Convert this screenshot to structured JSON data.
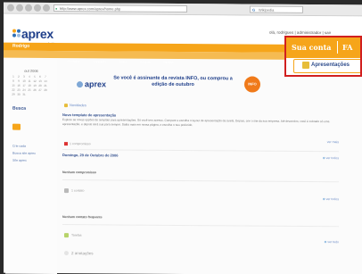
{
  "browser": {
    "url": "http://www.aprex.com/aprex/home.php",
    "search_placeholder": "Wikipedia",
    "right_text": "olá, rodrigues | administrador | sair"
  },
  "site": {
    "logo_text": "aprex",
    "logo_sub": "beta",
    "menu_label": "Rodrigo",
    "user_info": "olá, rodrigues | administrador | sair",
    "subnav_tabs": [
      "Home",
      "Compromissos",
      "Contatos",
      "Conteúdo",
      "Fotos",
      "Grupos",
      "Tarefas"
    ]
  },
  "sidebar": {
    "calendar_title": "out 2006",
    "calendar_days": [
      "1",
      "2",
      "3",
      "4",
      "5",
      "6",
      "7",
      "8",
      "9",
      "10",
      "11",
      "12",
      "13",
      "14",
      "15",
      "16",
      "17",
      "18",
      "19",
      "20",
      "21",
      "22",
      "23",
      "24",
      "25",
      "26",
      "27",
      "28",
      "29",
      "30",
      "31"
    ],
    "section_heading": "Busca",
    "links": [
      "Crie cada",
      "Busca site aprex",
      "Site aprex"
    ]
  },
  "banner": {
    "logo": "aprex",
    "text": "Se você é assinante da revista INFO, ou comprou a edição de outubro",
    "badge": "INFO"
  },
  "content": {
    "bullet_head": "Novidades",
    "title": "Novo template de apresentação",
    "paragraph": "Explore as novas opções de template para apresentações. Só você tem acesso. Compare e escolha o layout de apresentação da tarefa. Depois, crie o site da sua empresa. Até dezembro, você é cobrado só uma apresentação, e depois será sua para sempre. Saiba mais em nossa página, e escolha o seu preferido.",
    "tag": "1 compromisso",
    "date": "Domingo, 29 de Outubro de 2006",
    "right_link_1": "ver mais",
    "right_link_2": "ver todos",
    "section_1": "Nenhum compromisso",
    "item_1": "1 contato",
    "section_2": "Nenhum contato frequente",
    "item_2": "Tarefas",
    "item_3": "2 anotações",
    "right_link_3": "ver todos",
    "right_link_4": "ver tudo"
  },
  "zoom": {
    "tab_1": "Sua conta",
    "tab_2": "FA",
    "apresentacoes": "Apresentações"
  },
  "colors": {
    "brand_orange": "#f6a51a",
    "brand_blue": "#1f3f8a",
    "highlight_red": "#d11f1f"
  }
}
